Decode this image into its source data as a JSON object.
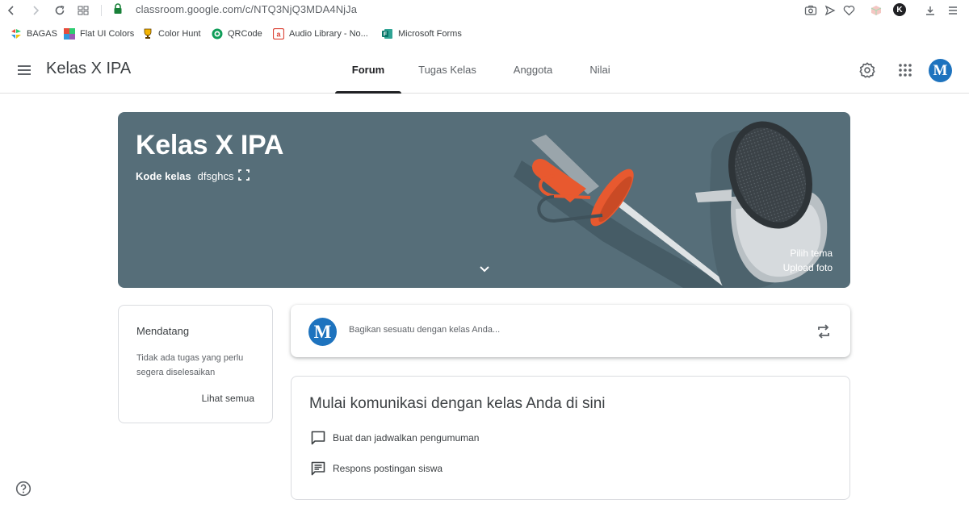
{
  "browser": {
    "url": "classroom.google.com/c/NTQ3NjQ3MDA4NjJa",
    "profile_initial": "K",
    "bookmarks": [
      {
        "label": "BAGAS",
        "icon": "bookmark-icon"
      },
      {
        "label": "Flat UI Colors",
        "icon": "palette-icon"
      },
      {
        "label": "Color Hunt",
        "icon": "trophy-icon"
      },
      {
        "label": "QRCode",
        "icon": "qr-icon"
      },
      {
        "label": "Audio Library - No...",
        "icon": "audio-icon"
      },
      {
        "label": "Microsoft Forms",
        "icon": "forms-icon"
      }
    ]
  },
  "header": {
    "class_name": "Kelas X IPA",
    "tabs": [
      {
        "label": "Forum",
        "active": true
      },
      {
        "label": "Tugas Kelas",
        "active": false
      },
      {
        "label": "Anggota",
        "active": false
      },
      {
        "label": "Nilai",
        "active": false
      }
    ],
    "avatar_initial": "M",
    "avatar_color": "#1e73be"
  },
  "banner": {
    "title": "Kelas X IPA",
    "code_label": "Kode kelas",
    "code_value": "dfsghcs",
    "select_theme": "Pilih tema",
    "upload_photo": "Upload foto",
    "background_color": "#566e79",
    "accent_color": "#e8592f"
  },
  "upcoming": {
    "title": "Mendatang",
    "empty_text": "Tidak ada tugas yang perlu segera diselesaikan",
    "view_all": "Lihat semua"
  },
  "share": {
    "avatar_initial": "M",
    "placeholder": "Bagikan sesuatu dengan kelas Anda..."
  },
  "getting_started": {
    "title": "Mulai komunikasi dengan kelas Anda di sini",
    "items": [
      {
        "label": "Buat dan jadwalkan pengumuman",
        "icon": "announcement-icon"
      },
      {
        "label": "Respons postingan siswa",
        "icon": "comment-icon"
      }
    ]
  }
}
